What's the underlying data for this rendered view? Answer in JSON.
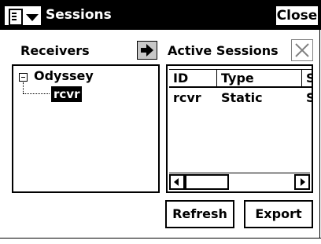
{
  "window": {
    "title": "Sessions",
    "close_label": "Close"
  },
  "icons": {
    "menu": "document-menu-icon",
    "add": "arrow-right-icon",
    "clear": "close-x-icon"
  },
  "receivers": {
    "label": "Receivers",
    "tree": {
      "root": "Odyssey",
      "child": "rcvr"
    }
  },
  "active_sessions": {
    "label": "Active Sessions",
    "columns": [
      "ID",
      "Type",
      "S"
    ],
    "rows": [
      [
        "rcvr",
        "Static",
        "S"
      ]
    ]
  },
  "buttons": {
    "refresh": "Refresh",
    "export": "Export"
  }
}
